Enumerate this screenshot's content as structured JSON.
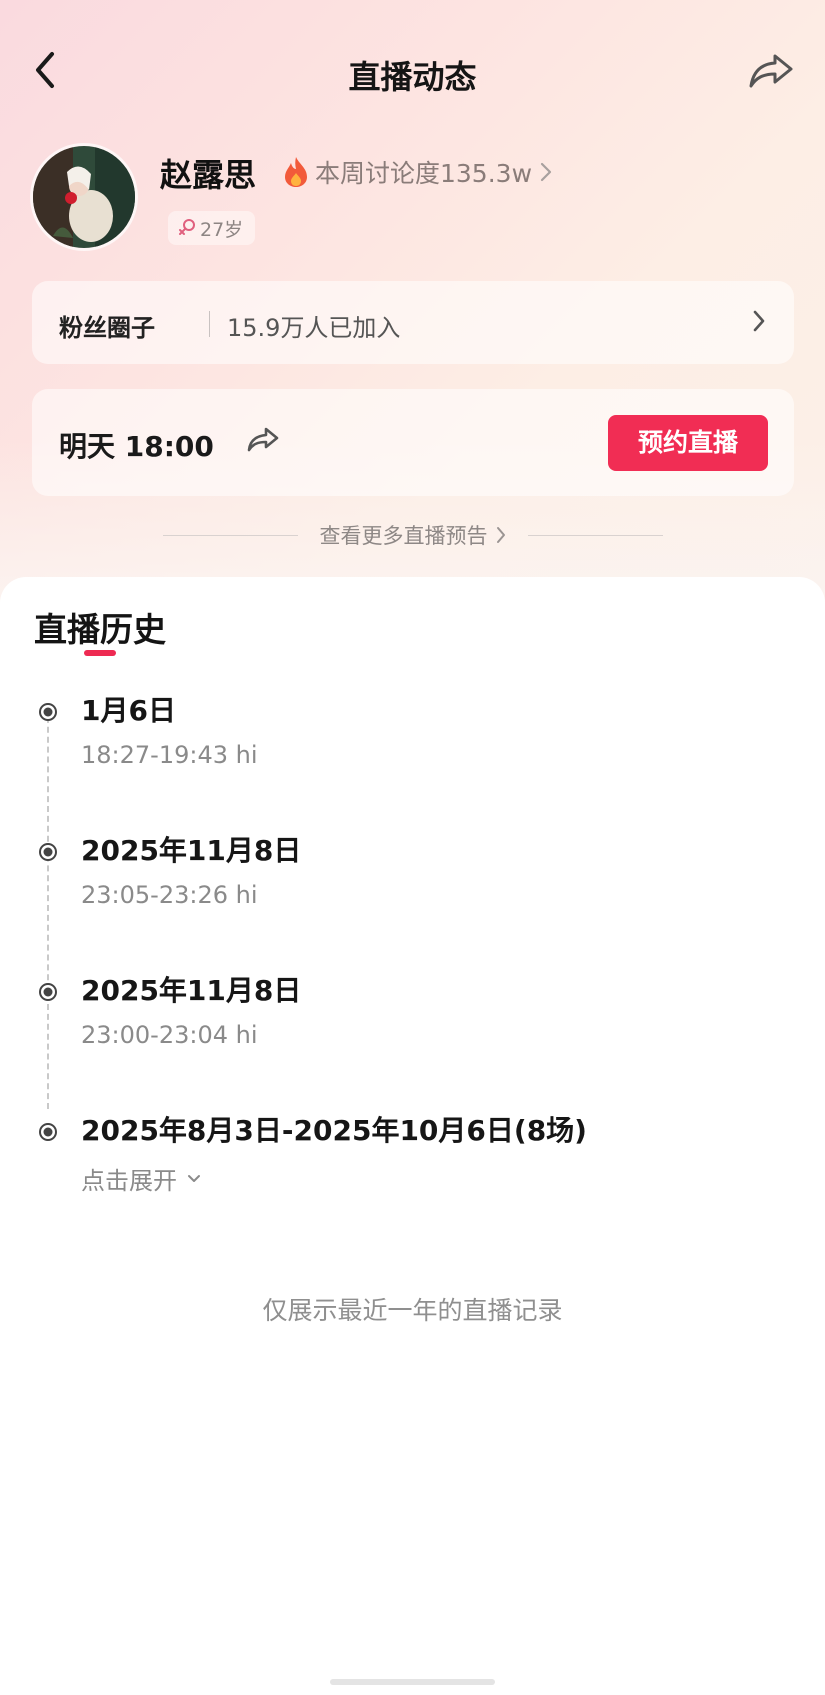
{
  "header": {
    "title": "直播动态"
  },
  "profile": {
    "name": "赵露思",
    "heat_label": "本周讨论度135.3w",
    "age": "27岁"
  },
  "fans_circle": {
    "label": "粉丝圈子",
    "count": "15.9万人已加入"
  },
  "upcoming": {
    "time": "明天 18:00",
    "button_label": "预约直播",
    "more_label": "查看更多直播预告"
  },
  "history": {
    "title": "直播历史",
    "entries": [
      {
        "date": "1月6日",
        "detail": "18:27-19:43 hi"
      },
      {
        "date": "2025年11月8日",
        "detail": "23:05-23:26 hi"
      },
      {
        "date": "2025年11月8日",
        "detail": "23:00-23:04 hi"
      },
      {
        "date": "2025年8月3日-2025年10月6日(8场)",
        "expand_label": "点击展开"
      }
    ]
  },
  "footer": {
    "note": "仅展示最近一年的直播记录"
  },
  "colors": {
    "accent": "#f12d54",
    "underline": "#ee2a52",
    "secondary_text": "#8a8a8a"
  },
  "icons": [
    "back-icon",
    "share-icon",
    "flame-icon",
    "chevron-right-icon",
    "female-icon",
    "forward-icon",
    "chevron-down-icon",
    "timeline-dot-icon"
  ]
}
